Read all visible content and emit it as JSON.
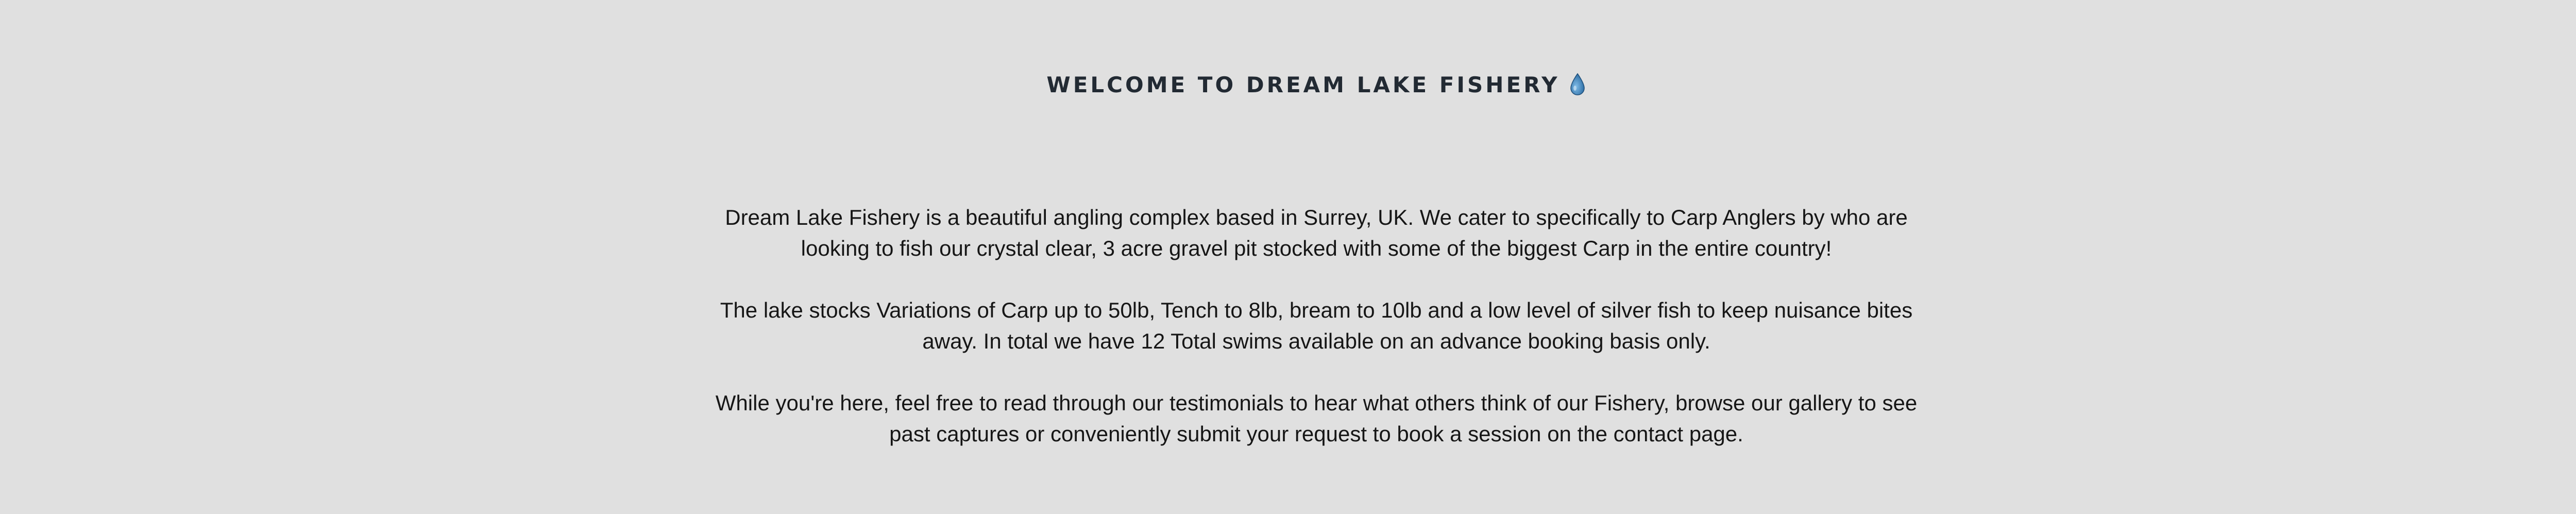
{
  "header": {
    "title": "WELCOME TO DREAM LAKE FISHERY",
    "title_icon": "water-drop-icon"
  },
  "intro": {
    "paragraphs": [
      "Dream Lake Fishery is a beautiful angling complex based in Surrey, UK. We cater to specifically to Carp Anglers by who are looking to fish our crystal clear, 3 acre gravel pit stocked with some of the biggest Carp in the entire country!",
      "The lake stocks Variations of Carp up to 50lb, Tench to 8lb, bream to 10lb and a low level of silver fish to keep nuisance bites away. In total we have 12 Total swims available on an advance booking basis only.",
      "While you're here, feel free to read through our testimonials to hear what others think of our Fishery, browse our gallery to see past captures or conveniently submit your request to book a session on the contact page."
    ]
  },
  "colors": {
    "background": "#e0e0e0",
    "heading": "#222a33",
    "body_text": "#161616",
    "drop_fill": "#4a90c8"
  }
}
